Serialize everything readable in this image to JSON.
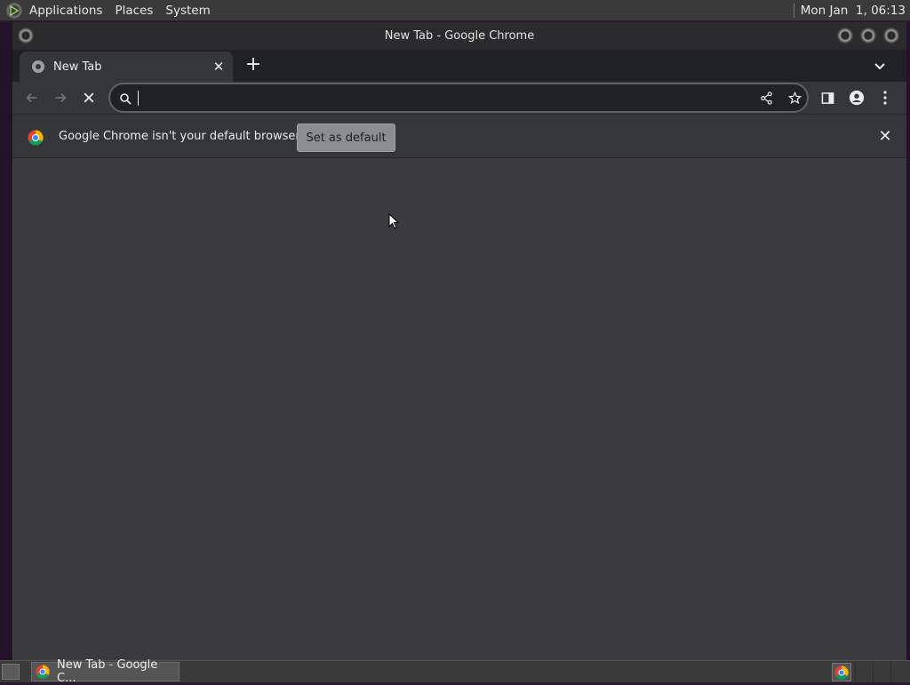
{
  "top_panel": {
    "menus": [
      "Applications",
      "Places",
      "System"
    ],
    "clock": "Mon Jan  1, 06:13"
  },
  "window": {
    "title": "New Tab - Google Chrome"
  },
  "tabs": [
    {
      "label": "New Tab",
      "icon": "chrome-newtab-icon",
      "active": true
    }
  ],
  "omnibox": {
    "value": "",
    "placeholder": ""
  },
  "infobar": {
    "message": "Google Chrome isn't your default browser",
    "button_label": "Set as default"
  },
  "taskbar": {
    "task_label": "New Tab - Google C..."
  },
  "colors": {
    "frame": "#202124",
    "toolbar": "#35363a",
    "content": "#3b3b3f",
    "infobar_button": "#8a8e93"
  }
}
